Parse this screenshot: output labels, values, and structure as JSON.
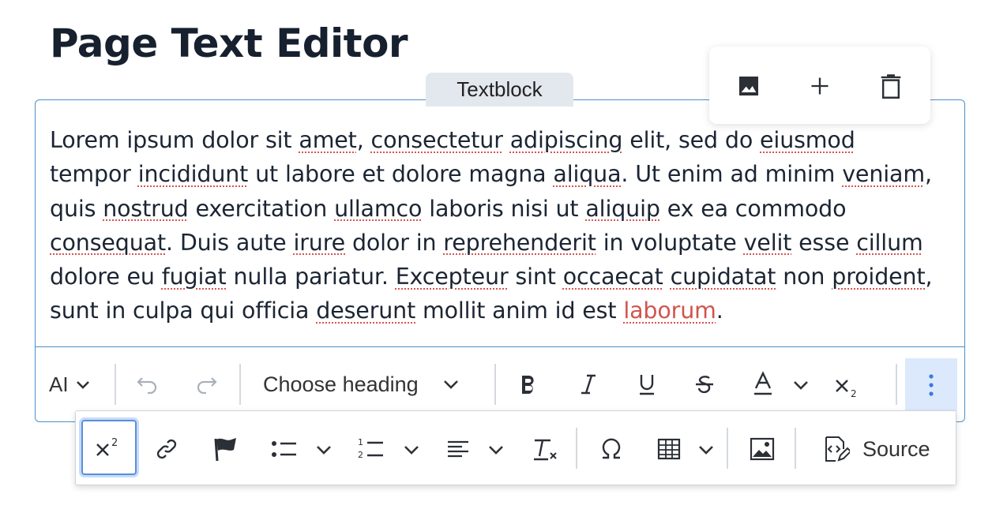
{
  "page": {
    "title": "Page Text Editor"
  },
  "block": {
    "label": "Textblock"
  },
  "block_toolbar": {
    "icons": [
      "image-icon",
      "plus-icon",
      "trash-icon"
    ]
  },
  "editor": {
    "lines": [
      [
        {
          "t": "Lorem ipsum dolor sit "
        },
        {
          "t": "amet",
          "s": 1
        },
        {
          "t": ", "
        },
        {
          "t": "consectetur",
          "s": 1
        },
        {
          "t": " "
        },
        {
          "t": "adipiscing",
          "s": 1
        },
        {
          "t": " elit, sed do "
        },
        {
          "t": "eiusmod",
          "s": 1
        }
      ],
      [
        {
          "t": "tempor "
        },
        {
          "t": "incididunt",
          "s": 1
        },
        {
          "t": " ut labore et dolore magna "
        },
        {
          "t": "aliqua",
          "s": 1
        },
        {
          "t": ". Ut enim ad minim "
        },
        {
          "t": "veniam",
          "s": 1
        },
        {
          "t": ","
        }
      ],
      [
        {
          "t": "quis "
        },
        {
          "t": "nostrud",
          "s": 1
        },
        {
          "t": " exercitation "
        },
        {
          "t": "ullamco",
          "s": 1
        },
        {
          "t": " laboris nisi ut "
        },
        {
          "t": "aliquip",
          "s": 1
        },
        {
          "t": " ex ea commodo"
        }
      ],
      [
        {
          "t": "consequat",
          "s": 1
        },
        {
          "t": ". Duis aute "
        },
        {
          "t": "irure",
          "s": 1
        },
        {
          "t": " dolor in "
        },
        {
          "t": "reprehenderit",
          "s": 1
        },
        {
          "t": " in voluptate "
        },
        {
          "t": "velit",
          "s": 1
        },
        {
          "t": " esse "
        },
        {
          "t": "cillum",
          "s": 1
        }
      ],
      [
        {
          "t": "dolore eu "
        },
        {
          "t": "fugiat",
          "s": 1
        },
        {
          "t": " nulla pariatur. "
        },
        {
          "t": "Excepteur",
          "s": 1
        },
        {
          "t": " sint "
        },
        {
          "t": "occaecat",
          "s": 1
        },
        {
          "t": " "
        },
        {
          "t": "cupidatat",
          "s": 1
        },
        {
          "t": " non "
        },
        {
          "t": "proident",
          "s": 1
        },
        {
          "t": ","
        }
      ],
      [
        {
          "t": "sunt in culpa qui officia "
        },
        {
          "t": "deserunt",
          "s": 1
        },
        {
          "t": " mollit anim id est "
        },
        {
          "t": "laborum",
          "s": 1,
          "c": "laborum"
        },
        {
          "t": "."
        }
      ]
    ]
  },
  "toolbar": {
    "ai_label": "AI",
    "heading_label": "Choose heading",
    "icons": [
      "undo-icon",
      "redo-icon",
      "bold-icon",
      "italic-icon",
      "underline-icon",
      "strikethrough-icon",
      "font-color-icon",
      "subscript-icon",
      "more-vertical-icon"
    ]
  },
  "overflow_toolbar": {
    "source_label": "Source",
    "icons": [
      "superscript-icon",
      "link-icon",
      "flag-icon",
      "bulleted-list-icon",
      "numbered-list-icon",
      "align-icon",
      "remove-format-icon",
      "special-characters-icon",
      "table-icon",
      "insert-image-icon",
      "source-icon"
    ]
  },
  "colors": {
    "focus_border": "#4a90c9",
    "active_bg": "#dce9fc",
    "spell_error": "#d9534f",
    "title": "#17202e"
  }
}
